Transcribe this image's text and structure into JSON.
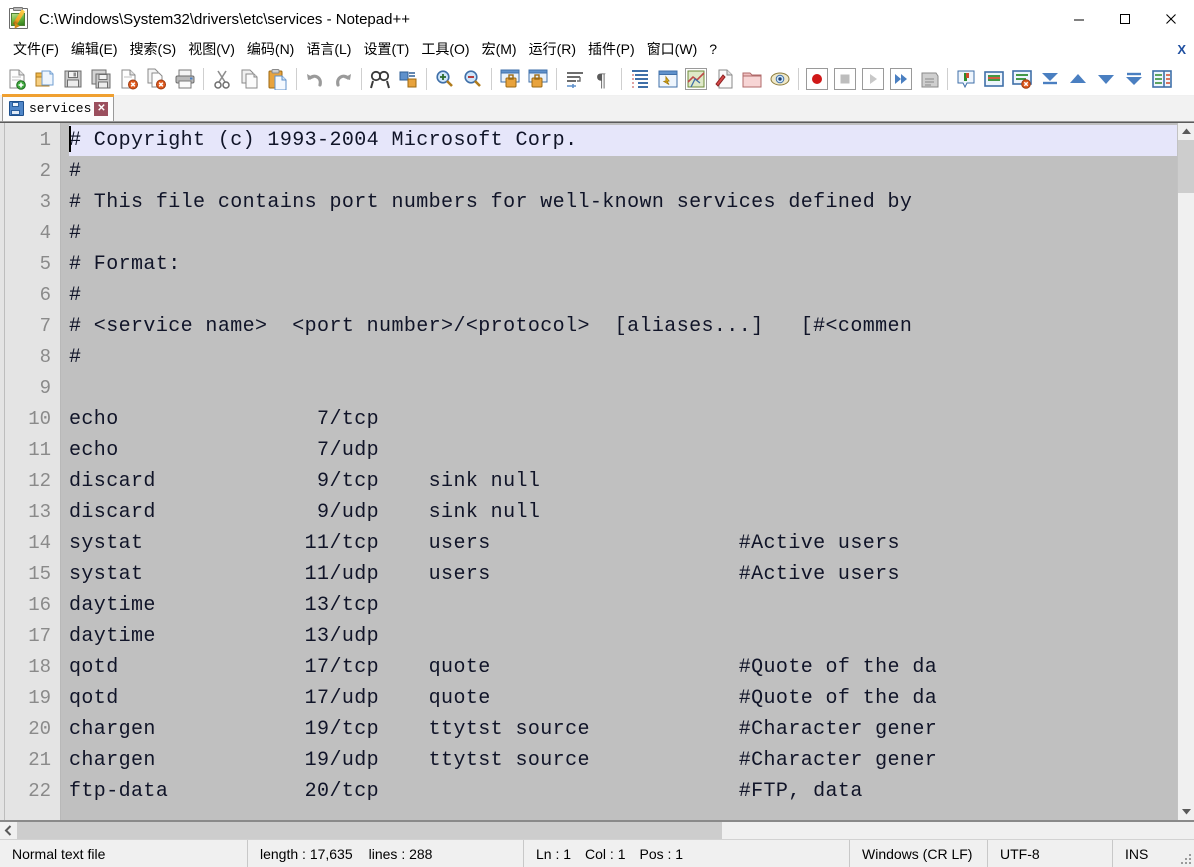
{
  "window": {
    "title": "C:\\Windows\\System32\\drivers\\etc\\services - Notepad++",
    "app_icon": "notepad-plus-plus-icon",
    "minimize_label": "—",
    "maximize_label": "□",
    "close_label": "✕"
  },
  "menubar": {
    "items": [
      {
        "label": "文件(F)",
        "name": "menu-file"
      },
      {
        "label": "编辑(E)",
        "name": "menu-edit"
      },
      {
        "label": "搜索(S)",
        "name": "menu-search"
      },
      {
        "label": "视图(V)",
        "name": "menu-view"
      },
      {
        "label": "编码(N)",
        "name": "menu-encoding"
      },
      {
        "label": "语言(L)",
        "name": "menu-language"
      },
      {
        "label": "设置(T)",
        "name": "menu-settings"
      },
      {
        "label": "工具(O)",
        "name": "menu-tools"
      },
      {
        "label": "宏(M)",
        "name": "menu-macro"
      },
      {
        "label": "运行(R)",
        "name": "menu-run"
      },
      {
        "label": "插件(P)",
        "name": "menu-plugins"
      },
      {
        "label": "窗口(W)",
        "name": "menu-window"
      },
      {
        "label": "?",
        "name": "menu-help"
      }
    ],
    "close_document_label": "X"
  },
  "toolbar": {
    "buttons": [
      "new-file-icon",
      "open-file-icon",
      "save-icon",
      "save-all-icon",
      "close-file-icon",
      "close-all-files-icon",
      "print-icon",
      "sep",
      "cut-icon",
      "copy-icon",
      "paste-icon",
      "sep",
      "undo-icon",
      "redo-icon",
      "sep",
      "find-icon",
      "replace-icon",
      "sep",
      "zoom-in-icon",
      "zoom-out-icon",
      "sep",
      "sync-vertical-scroll-icon",
      "sync-horizontal-scroll-icon",
      "sep",
      "word-wrap-icon",
      "show-all-characters-icon",
      "sep",
      "indent-guide-icon",
      "user-defined-language-icon",
      "document-map-icon",
      "function-list-icon",
      "folder-as-workspace-icon",
      "monitoring-icon",
      "sep",
      "record-macro-icon",
      "stop-recording-icon",
      "play-macro-icon",
      "run-macro-multiple-icon",
      "save-macro-icon",
      "sep",
      "bookmark-icon",
      "remove-bookmark-icon",
      "remove-all-bookmarks-icon",
      "jump-up-icon",
      "arrow-up-icon",
      "arrow-down-icon",
      "jump-down-icon",
      "compare-icon"
    ]
  },
  "tabs": {
    "items": [
      {
        "label": "services",
        "icon": "saved-document-icon",
        "close": "✕",
        "active": true
      }
    ]
  },
  "editor": {
    "first_line_number": 1,
    "current_line": 1,
    "line_numbers": [
      1,
      2,
      3,
      4,
      5,
      6,
      7,
      8,
      9,
      10,
      11,
      12,
      13,
      14,
      15,
      16,
      17,
      18,
      19,
      20,
      21,
      22
    ],
    "lines": [
      "# Copyright (c) 1993-2004 Microsoft Corp.",
      "#",
      "# This file contains port numbers for well-known services defined by",
      "#",
      "# Format:",
      "#",
      "# <service name>  <port number>/<protocol>  [aliases...]   [#<commen",
      "#",
      "",
      "echo                7/tcp",
      "echo                7/udp",
      "discard             9/tcp    sink null",
      "discard             9/udp    sink null",
      "systat             11/tcp    users                    #Active users",
      "systat             11/udp    users                    #Active users",
      "daytime            13/tcp",
      "daytime            13/udp",
      "qotd               17/tcp    quote                    #Quote of the da",
      "qotd               17/udp    quote                    #Quote of the da",
      "chargen            19/tcp    ttytst source            #Character gener",
      "chargen            19/udp    ttytst source            #Character gener",
      "ftp-data           20/tcp                             #FTP, data"
    ],
    "colors": {
      "background": "#c0c0c0",
      "text": "#101428",
      "gutter_background": "#e4e4e4",
      "gutter_text": "#8a8a8a",
      "current_line_highlight": "#e6e6fa"
    }
  },
  "statusbar": {
    "file_type": "Normal text file",
    "length_label": "length : 17,635",
    "lines_label": "lines : 288",
    "ln": "Ln : 1",
    "col": "Col : 1",
    "pos": "Pos : 1",
    "eol": "Windows (CR LF)",
    "encoding": "UTF-8",
    "insert_mode": "INS"
  }
}
